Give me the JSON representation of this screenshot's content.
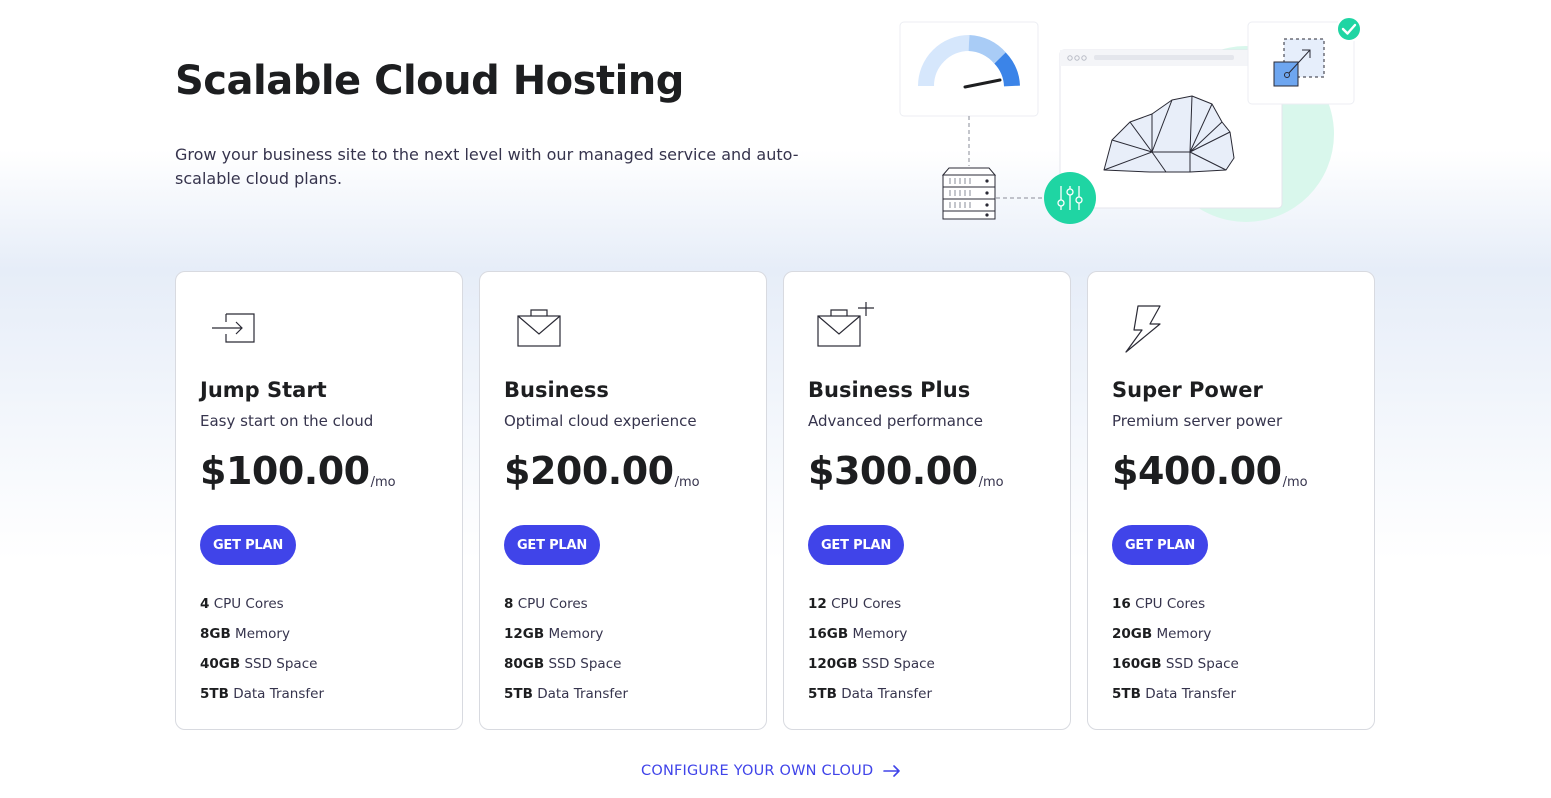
{
  "hero": {
    "title": "Scalable Cloud Hosting",
    "subtitle": "Grow your business site to the next level with our managed service and auto-scalable cloud plans."
  },
  "illustration": {
    "icons": [
      "speedometer-icon",
      "server-rack-icon",
      "sliders-icon",
      "browser-window-icon",
      "cloud-icon",
      "scale-up-icon",
      "check-circle-icon"
    ],
    "colors": {
      "accent_green": "#1fd5a3",
      "light_blue": "#cfe2fb",
      "blue": "#3b84e8"
    }
  },
  "plans": [
    {
      "name": "Jump Start",
      "desc": "Easy start on the cloud",
      "price": "$100.00",
      "per": "/mo",
      "button": "GET PLAN",
      "icon": "arrow-into-box-icon",
      "features": [
        {
          "value": "4",
          "label": " CPU Cores"
        },
        {
          "value": "8GB",
          "label": " Memory"
        },
        {
          "value": "40GB",
          "label": " SSD Space"
        },
        {
          "value": "5TB",
          "label": " Data Transfer"
        }
      ]
    },
    {
      "name": "Business",
      "desc": "Optimal cloud experience",
      "price": "$200.00",
      "per": "/mo",
      "button": "GET PLAN",
      "icon": "briefcase-icon",
      "features": [
        {
          "value": "8",
          "label": " CPU Cores"
        },
        {
          "value": "12GB",
          "label": " Memory"
        },
        {
          "value": "80GB",
          "label": " SSD Space"
        },
        {
          "value": "5TB",
          "label": " Data Transfer"
        }
      ]
    },
    {
      "name": "Business Plus",
      "desc": "Advanced performance",
      "price": "$300.00",
      "per": "/mo",
      "button": "GET PLAN",
      "icon": "briefcase-plus-icon",
      "features": [
        {
          "value": "12",
          "label": " CPU Cores"
        },
        {
          "value": "16GB",
          "label": " Memory"
        },
        {
          "value": "120GB",
          "label": " SSD Space"
        },
        {
          "value": "5TB",
          "label": " Data Transfer"
        }
      ]
    },
    {
      "name": "Super Power",
      "desc": "Premium server power",
      "price": "$400.00",
      "per": "/mo",
      "button": "GET PLAN",
      "icon": "lightning-icon",
      "features": [
        {
          "value": "16",
          "label": " CPU Cores"
        },
        {
          "value": "20GB",
          "label": " Memory"
        },
        {
          "value": "160GB",
          "label": " SSD Space"
        },
        {
          "value": "5TB",
          "label": " Data Transfer"
        }
      ]
    }
  ],
  "configure": {
    "label": "CONFIGURE YOUR OWN CLOUD",
    "icon": "arrow-right-icon"
  },
  "colors": {
    "primary": "#4044e9",
    "text": "#1d1e20",
    "muted": "#36344d",
    "border": "#d8dae0"
  }
}
